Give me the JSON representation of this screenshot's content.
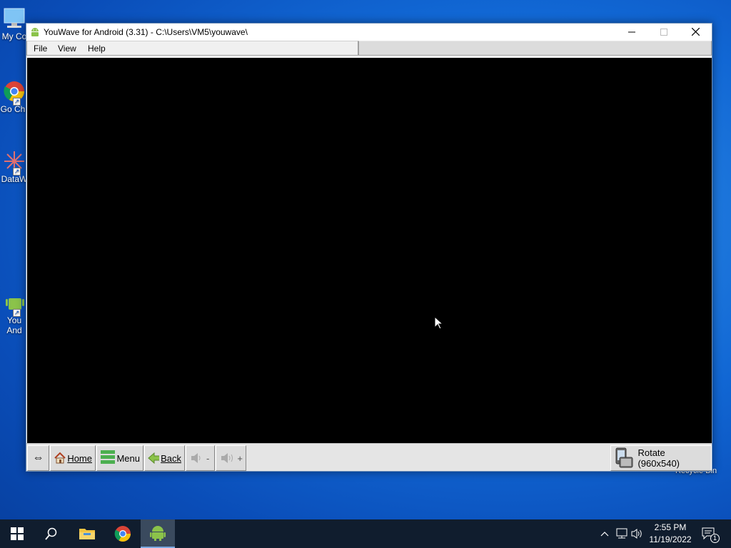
{
  "desktop": {
    "icons": [
      {
        "label": "My Co",
        "icon": "computer-icon"
      },
      {
        "label": "Go Chr",
        "icon": "chrome-icon"
      },
      {
        "label": "DataW",
        "icon": "datawatch-icon"
      },
      {
        "label": "You And",
        "icon": "android-icon"
      }
    ],
    "recycle_bin_label": "Recycle Bin"
  },
  "window": {
    "title": "YouWave for Android (3.31) - C:\\Users\\VM5\\youwave\\",
    "icon": "android-icon",
    "controls": {
      "minimize": "minimize-icon",
      "maximize": "maximize-icon",
      "close": "close-icon"
    },
    "menu": [
      {
        "label": "File"
      },
      {
        "label": "View"
      },
      {
        "label": "Help"
      }
    ],
    "toolbar": {
      "resize_label": "⇔",
      "home_label": "Home",
      "menu_label": "Menu",
      "back_label": "Back",
      "vol_down_label": "-",
      "vol_up_label": "+",
      "rotate_label": "Rotate (960x540)"
    }
  },
  "taskbar": {
    "items": [
      {
        "name": "start",
        "icon": "windows-logo-icon"
      },
      {
        "name": "search",
        "icon": "search-icon"
      },
      {
        "name": "file-explorer",
        "icon": "folder-icon"
      },
      {
        "name": "chrome",
        "icon": "chrome-icon"
      },
      {
        "name": "youwave",
        "icon": "android-icon",
        "active": true
      }
    ],
    "clock": {
      "time": "2:55 PM",
      "date": "11/19/2022"
    },
    "notification_count": "1"
  },
  "colors": {
    "desktop_bg": "#1167d4",
    "taskbar_bg": "#101d2e",
    "android_green": "#8bc34a",
    "screen_bg": "#000000"
  }
}
